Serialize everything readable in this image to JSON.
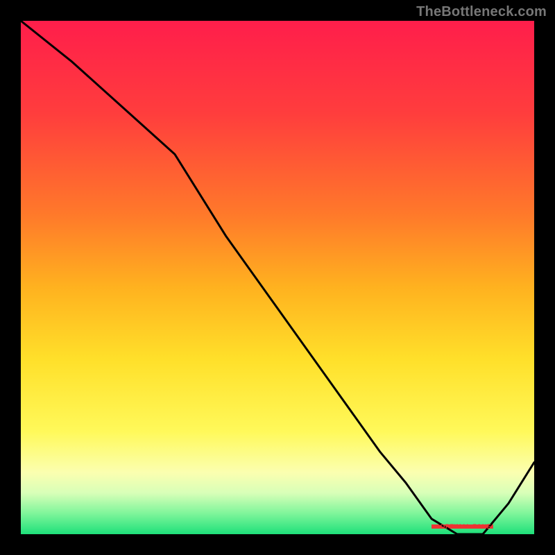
{
  "attribution": "TheBottleneck.com",
  "zone_label": "OPTIMAL ZONE",
  "chart_data": {
    "type": "line",
    "title": "",
    "xlabel": "",
    "ylabel": "",
    "xlim": [
      0,
      100
    ],
    "ylim": [
      0,
      100
    ],
    "series": [
      {
        "name": "curve",
        "x": [
          0,
          10,
          20,
          30,
          40,
          50,
          60,
          70,
          75,
          80,
          85,
          90,
          95,
          100
        ],
        "y": [
          100,
          92,
          83,
          74,
          58,
          44,
          30,
          16,
          10,
          3,
          0,
          0,
          6,
          14
        ]
      }
    ],
    "optimal_zone": {
      "x_start": 80,
      "x_end": 92
    },
    "gradient_stops": [
      {
        "offset": 0.0,
        "color": "#ff1e4b"
      },
      {
        "offset": 0.18,
        "color": "#ff3d3d"
      },
      {
        "offset": 0.38,
        "color": "#ff7a2a"
      },
      {
        "offset": 0.52,
        "color": "#ffb21f"
      },
      {
        "offset": 0.66,
        "color": "#ffe02a"
      },
      {
        "offset": 0.8,
        "color": "#fff95a"
      },
      {
        "offset": 0.88,
        "color": "#fbffb0"
      },
      {
        "offset": 0.92,
        "color": "#d8ffb8"
      },
      {
        "offset": 0.96,
        "color": "#7ef59a"
      },
      {
        "offset": 1.0,
        "color": "#1ee07a"
      }
    ]
  }
}
